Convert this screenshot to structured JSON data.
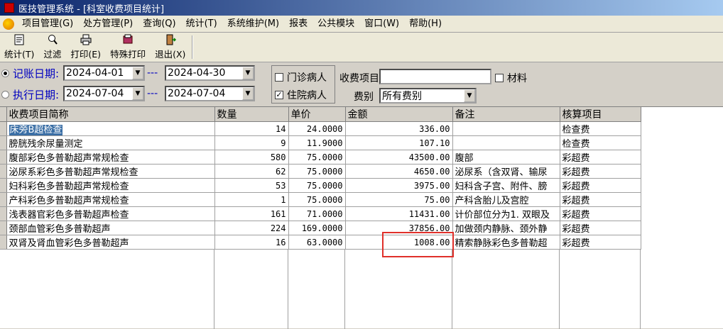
{
  "window": {
    "title": "医技管理系统 - [科室收费项目统计]"
  },
  "menu": [
    "项目管理(G)",
    "处方管理(P)",
    "查询(Q)",
    "统计(T)",
    "系统维护(M)",
    "报表",
    "公共模块",
    "窗口(W)",
    "帮助(H)"
  ],
  "toolbar": [
    {
      "label": "统计(T)",
      "icon": "statistics-icon"
    },
    {
      "label": "过滤",
      "icon": "filter-icon"
    },
    {
      "label": "打印(E)",
      "icon": "print-icon"
    },
    {
      "label": "特殊打印",
      "icon": "special-print-icon"
    },
    {
      "label": "退出(X)",
      "icon": "exit-icon"
    }
  ],
  "filters": {
    "billing_date_label": "记账日期:",
    "billing_date_from": "2024-04-01",
    "billing_date_to": "2024-04-30",
    "exec_date_label": "执行日期:",
    "exec_date_from": "2024-07-04",
    "exec_date_to": "2024-07-04",
    "dashes": "---",
    "outpatient_label": "门诊病人",
    "outpatient_checked": false,
    "inpatient_label": "住院病人",
    "inpatient_checked": true,
    "charge_item_label": "收费项目",
    "charge_item_value": "",
    "material_label": "材料",
    "material_checked": false,
    "fee_type_label": "费别",
    "fee_type_value": "所有费别",
    "selected_date_mode": "billing"
  },
  "table": {
    "columns": [
      "收费项目简称",
      "数量",
      "单价",
      "金额",
      "备注",
      "核算项目"
    ],
    "rows": [
      [
        "床旁B超检查",
        "14",
        "24.0000",
        "336.00",
        "",
        "检查费"
      ],
      [
        "膀胱残余尿量测定",
        "9",
        "11.9000",
        "107.10",
        "",
        "检查费"
      ],
      [
        "腹部彩色多普勒超声常规检查",
        "580",
        "75.0000",
        "43500.00",
        "腹部",
        "彩超费"
      ],
      [
        "泌尿系彩色多普勒超声常规检查",
        "62",
        "75.0000",
        "4650.00",
        "泌尿系（含双肾、输尿",
        "彩超费"
      ],
      [
        "妇科彩色多普勒超声常规检查",
        "53",
        "75.0000",
        "3975.00",
        "妇科含子宫、附件、膀",
        "彩超费"
      ],
      [
        "产科彩色多普勒超声常规检查",
        "1",
        "75.0000",
        "75.00",
        "产科含胎儿及宫腔",
        "彩超费"
      ],
      [
        "浅表器官彩色多普勒超声检查",
        "161",
        "71.0000",
        "11431.00",
        "计价部位分为1. 双眼及",
        "彩超费"
      ],
      [
        "颈部血管彩色多普勒超声",
        "224",
        "169.0000",
        "37856.00",
        "加做颈内静脉、颈外静",
        "彩超费"
      ],
      [
        "双肾及肾血管彩色多普勒超声",
        "16",
        "63.0000",
        "1008.00",
        "精索静脉彩色多普勒超",
        "彩超费"
      ]
    ],
    "selected_row": 0
  }
}
